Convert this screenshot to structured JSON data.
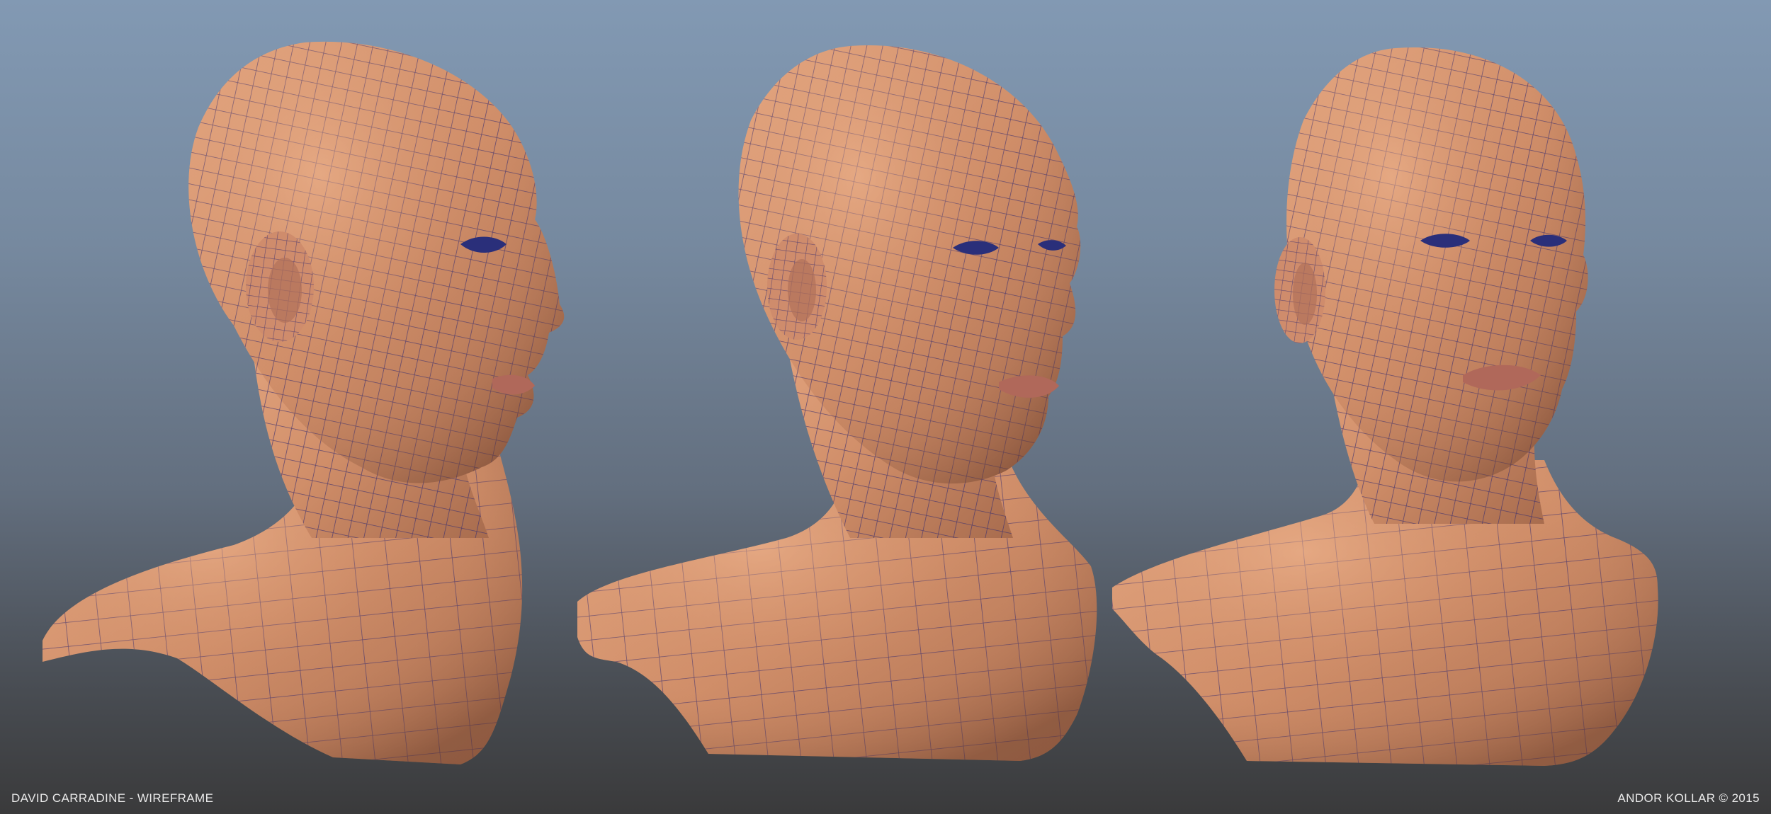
{
  "caption_left": "DAVID CARRADINE - WIREFRAME",
  "caption_right": "ANDOR KOLLAR © 2015",
  "colors": {
    "skin_light": "#e3a27e",
    "skin_mid": "#c98864",
    "skin_dark": "#8e5a41",
    "wire": "#3b2e6e",
    "eye": "#2a2f7a"
  }
}
